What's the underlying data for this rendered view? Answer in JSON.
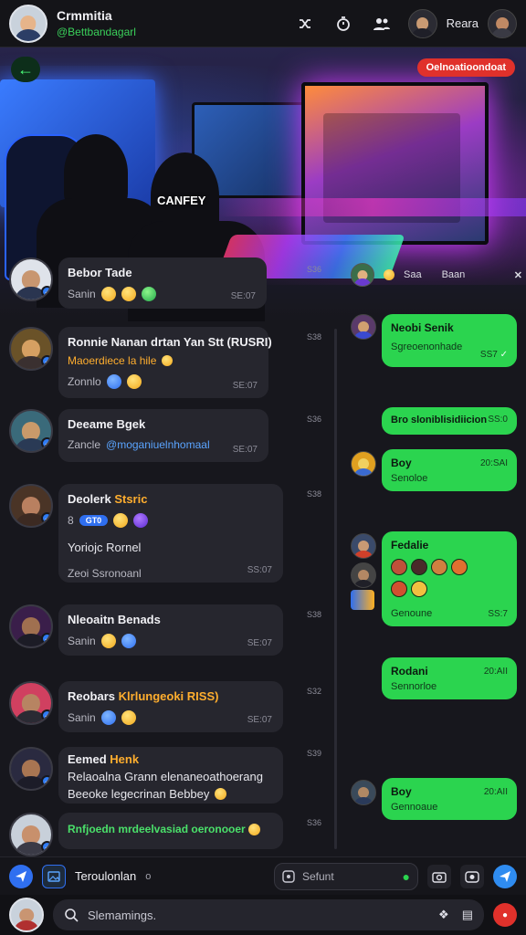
{
  "header": {
    "title": "Crmmitia",
    "subtitle": "@Bettbandagarl",
    "user_name": "Reara",
    "actions": [
      "shuffle-icon",
      "timer-icon",
      "group-icon"
    ]
  },
  "hero": {
    "back_icon": "back-arrow-icon",
    "badge": "Oelnoatioondoat",
    "caption": "CANFEY"
  },
  "right_strip": {
    "items": [
      "Saa",
      "Baan"
    ]
  },
  "chats": [
    {
      "name": "Bebor Tade",
      "line": "Sanin",
      "time": "SE:07",
      "count": "S36"
    },
    {
      "name": "Ronnie Nanan drtan Yan Stt (RUSRI)",
      "line": "Maoerdiece la hile",
      "meta": "Zonnlo",
      "time": "SE:07",
      "count": "S38"
    },
    {
      "name": "Deeame Bgek",
      "line": "Zancle",
      "line2": "@moganiuelnhomaal",
      "time": "SE:07",
      "count": "S36"
    },
    {
      "name": "Deolerk",
      "name_accent": "Stsric",
      "tag": "8",
      "pill": "GT0",
      "line2": "Yoriojc Rornel",
      "meta": "Zeoi Ssronoanl",
      "time": "SS:07",
      "count": "S38"
    },
    {
      "name": "Nleoaitn Benads",
      "line": "Sanin",
      "time": "SE:07",
      "count": "S38"
    },
    {
      "name": "Reobars",
      "name_accent": "Klrlungeoki RISS)",
      "line": "Sanin",
      "time": "SE:07",
      "count": "S32"
    },
    {
      "name": "Eemed",
      "name_accent": "Henk",
      "line": "Relaoalna Grann elenaneoathoerang",
      "line2": "Beeoke legecrinan Bebbey",
      "count": "S39"
    },
    {
      "name": "Rnfjoedn mrdeelvasiad oeronooer",
      "count": "S36"
    }
  ],
  "messages": [
    {
      "title": "Neobi Senik",
      "sub": "Sgreoenonhade",
      "time": "SS7"
    },
    {
      "title": "Bro sloniblisidiicion",
      "time": "SS:0"
    },
    {
      "title": "Boy",
      "sub": "Senoloe",
      "time": "20:SAI"
    },
    {
      "title": "Fedalie",
      "sub": "Genoune",
      "time": "SS:7"
    },
    {
      "title": "Rodani",
      "sub": "Sennorloe",
      "time": "20:AII"
    },
    {
      "title": "Boy",
      "sub": "Gennoaue",
      "time": "20:AII"
    }
  ],
  "composer": {
    "label": "Teroulonlan",
    "sub": "o",
    "search_placeholder": "Sefunt"
  },
  "bottom": {
    "search_placeholder": "Slemamings."
  },
  "colors": {
    "accent_green": "#2bd44f",
    "badge_red": "#e0312b",
    "link_blue": "#2f7cf6",
    "accent_orange": "#ffae2e"
  }
}
